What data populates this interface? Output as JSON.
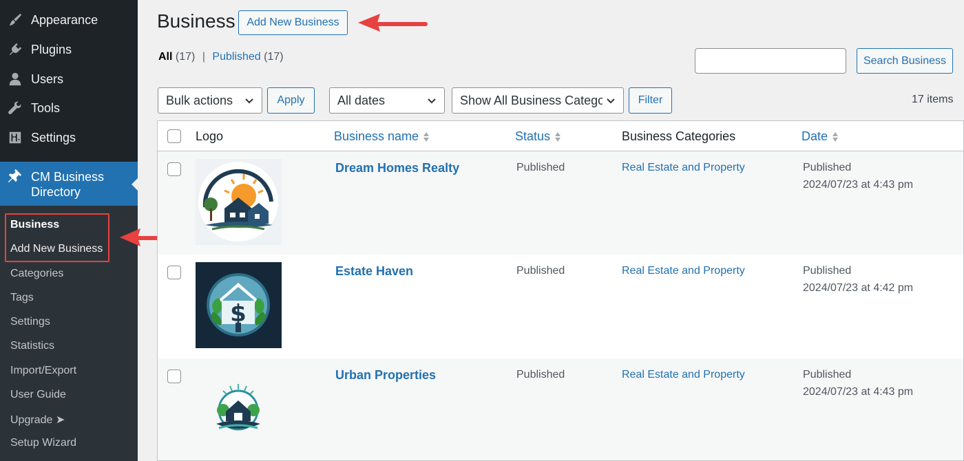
{
  "sidebar": {
    "menu": [
      {
        "label": "Appearance",
        "icon": "paintbrush-icon"
      },
      {
        "label": "Plugins",
        "icon": "plugin-icon"
      },
      {
        "label": "Users",
        "icon": "user-icon"
      },
      {
        "label": "Tools",
        "icon": "wrench-icon"
      },
      {
        "label": "Settings",
        "icon": "settings-sliders-icon"
      }
    ],
    "current": {
      "label": "CM Business Directory",
      "icon": "pushpin-icon"
    },
    "submenu": [
      "Business",
      "Add New Business",
      "Categories",
      "Tags",
      "Settings",
      "Statistics",
      "Import/Export",
      "User Guide",
      "Upgrade ➤",
      "Setup Wizard"
    ]
  },
  "page": {
    "title": "Business",
    "add_new_label": "Add New Business",
    "views": {
      "all_label": "All",
      "all_count": "(17)",
      "separator": "|",
      "published_label": "Published",
      "published_count": "(17)"
    },
    "search": {
      "value": "",
      "button_label": "Search Business"
    },
    "bulk_actions": {
      "selected": "Bulk actions",
      "apply_label": "Apply"
    },
    "dates_filter": {
      "selected": "All dates"
    },
    "category_filter": {
      "selected": "Show All Business Categori"
    },
    "filter_label": "Filter",
    "items_count": "17 items"
  },
  "table": {
    "columns": {
      "logo": "Logo",
      "name": "Business name",
      "status": "Status",
      "categories": "Business Categories",
      "date": "Date"
    },
    "rows": [
      {
        "name": "Dream Homes Realty",
        "status": "Published",
        "category": "Real Estate and Property",
        "date_status": "Published",
        "date": "2024/07/23 at 4:43 pm"
      },
      {
        "name": "Estate Haven",
        "status": "Published",
        "category": "Real Estate and Property",
        "date_status": "Published",
        "date": "2024/07/23 at 4:42 pm"
      },
      {
        "name": "Urban Properties",
        "status": "Published",
        "category": "Real Estate and Property",
        "date_status": "Published",
        "date": "2024/07/23 at 4:43 pm"
      }
    ]
  },
  "colors": {
    "accent": "#2271b1",
    "sidebar_bg": "#1d2327",
    "highlight_red": "#e8413f"
  }
}
